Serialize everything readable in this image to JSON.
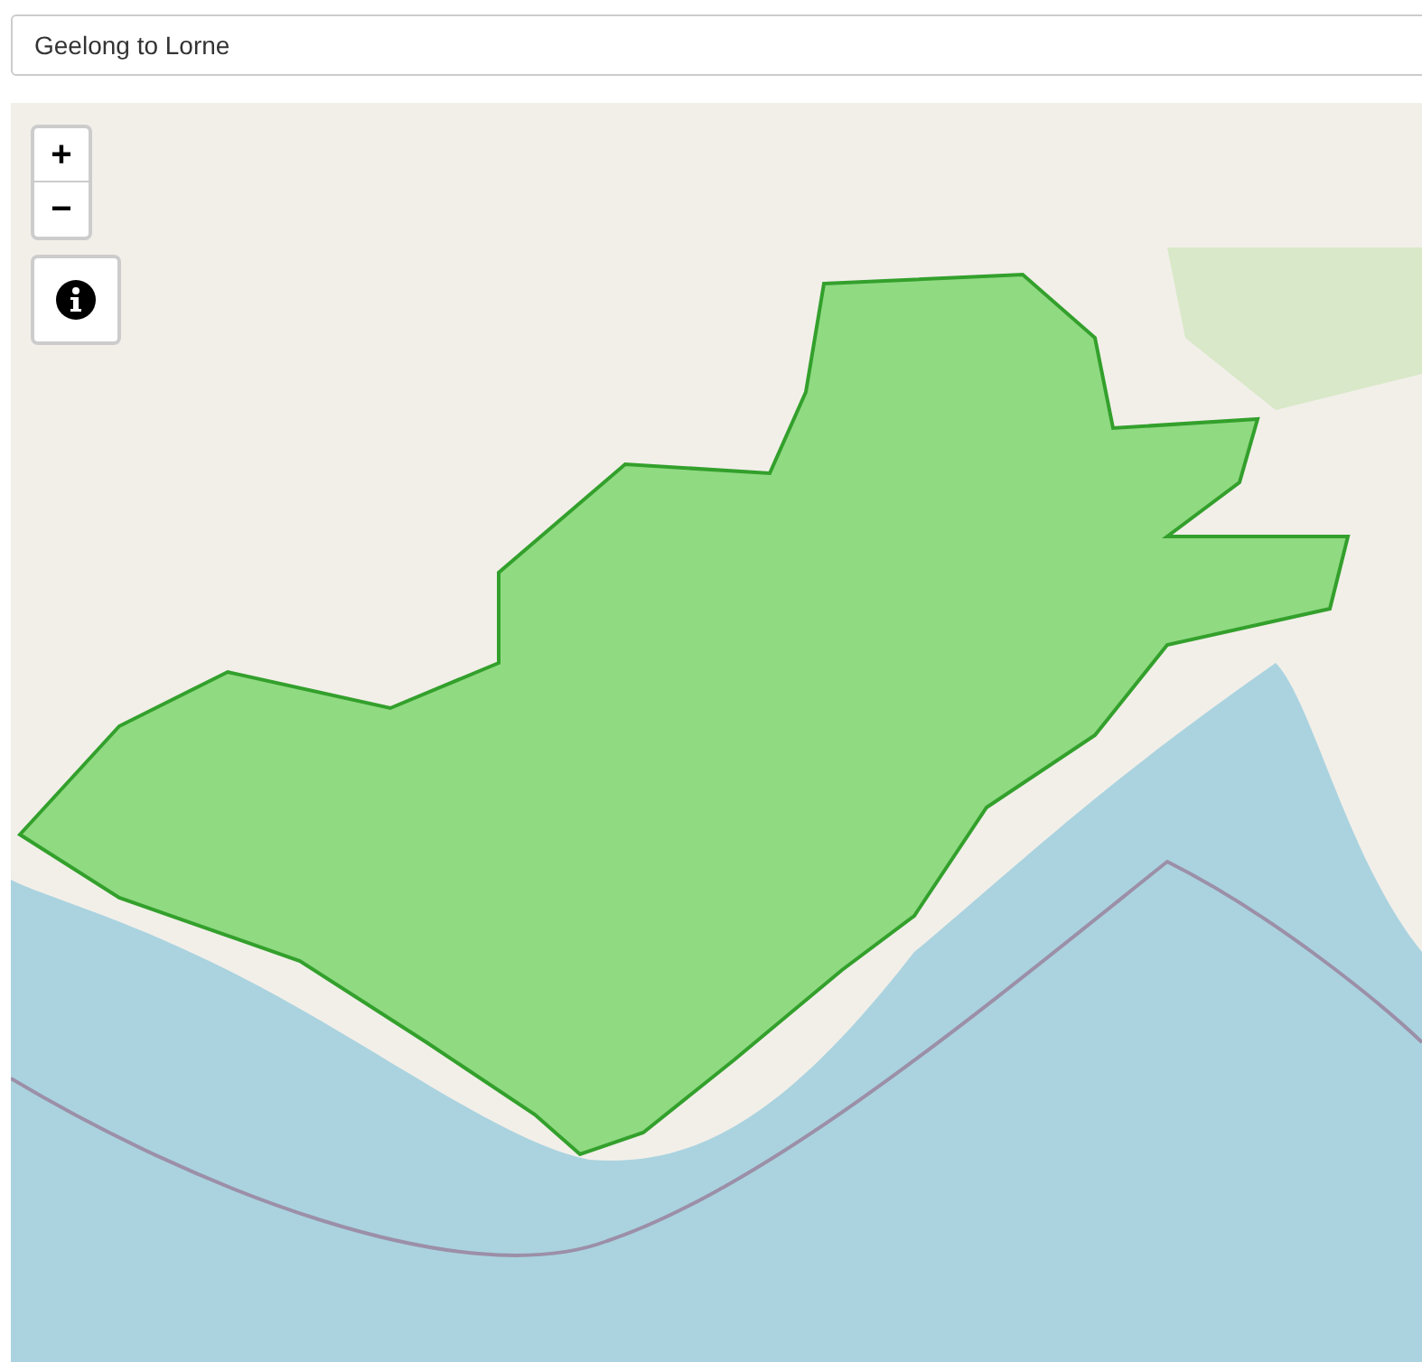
{
  "search": {
    "value": "Geelong to Lorne"
  },
  "zoom_controls": {
    "zoom_in": "+",
    "zoom_out": "−"
  }
}
